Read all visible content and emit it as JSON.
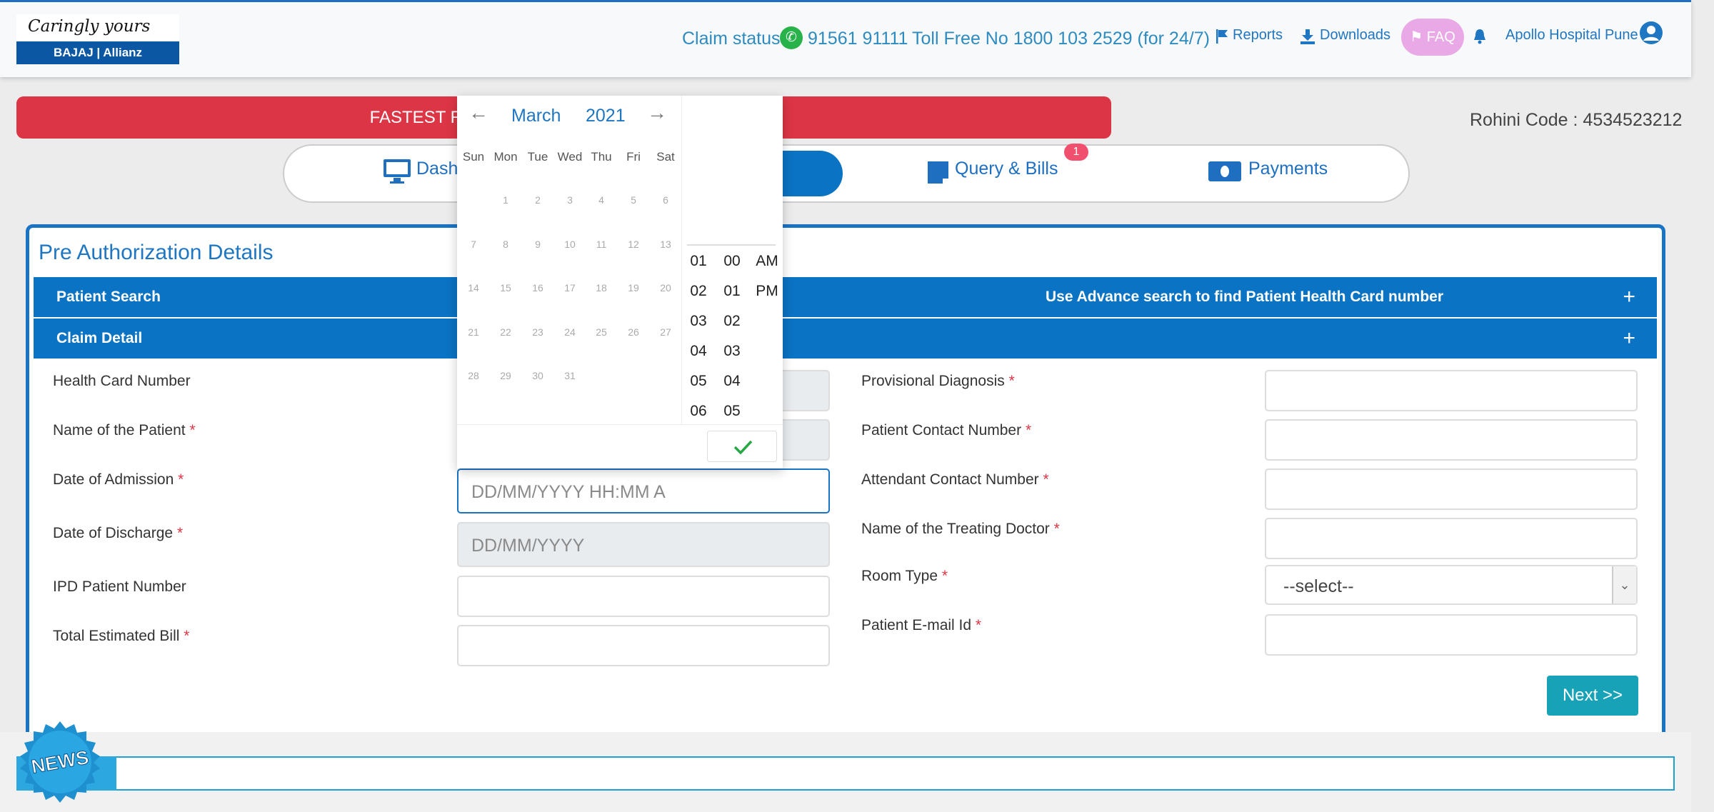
{
  "header": {
    "logo_tagline": "Caringly yours",
    "logo_brand": "BAJAJ | Allianz",
    "claim_status_label": "Claim status",
    "whatsapp_number": "91561 91111",
    "toll_free": "Toll Free No 1800 103 2529 (for 24/7)",
    "reports_label": "Reports",
    "downloads_label": "Downloads",
    "faq_label": "FAQ",
    "user_name": "Apollo Hospital Pune"
  },
  "banner": {
    "text": "FASTEST RESPONSE TO PRE-AUTHORIZATION"
  },
  "rohini_code": "Rohini Code : 4534523212",
  "nav": {
    "items": [
      {
        "label": "Dashboard"
      },
      {
        "label": "Query & Bills",
        "badge": "1"
      },
      {
        "label": "Payments"
      }
    ]
  },
  "card": {
    "title": "Pre Authorization Details",
    "patient_search": {
      "label": "Patient Search",
      "hint": "Use Advance search to find Patient Health Card number",
      "toggle": "+"
    },
    "claim_detail": {
      "label": "Claim Detail",
      "toggle": "+"
    },
    "left_fields": [
      {
        "label": "Health Card Number",
        "required": false,
        "value": ""
      },
      {
        "label": "Name of the Patient",
        "required": true,
        "value": ""
      },
      {
        "label": "Date of Admission",
        "required": true,
        "placeholder": "DD/MM/YYYY HH:MM A"
      },
      {
        "label": "Date of Discharge",
        "required": true,
        "placeholder": "DD/MM/YYYY"
      },
      {
        "label": "IPD Patient Number",
        "required": false,
        "value": ""
      },
      {
        "label": "Total Estimated Bill",
        "required": true,
        "value": ""
      }
    ],
    "right_fields": [
      {
        "label": "Provisional Diagnosis",
        "required": true,
        "value": ""
      },
      {
        "label": "Patient Contact Number",
        "required": true,
        "value": ""
      },
      {
        "label": "Attendant Contact Number",
        "required": true,
        "value": ""
      },
      {
        "label": "Name of the Treating Doctor",
        "required": true,
        "value": ""
      },
      {
        "label": "Room Type",
        "required": true,
        "selected": "--select--"
      },
      {
        "label": "Patient E-mail Id",
        "required": true,
        "value": ""
      }
    ],
    "required_marker": "*",
    "next_label": "Next >>"
  },
  "date_picker": {
    "prev": "←",
    "next": "→",
    "month": "March",
    "year": "2021",
    "weekdays": [
      "Sun",
      "Mon",
      "Tue",
      "Wed",
      "Thu",
      "Fri",
      "Sat"
    ],
    "days": [
      [
        "",
        "1",
        "2",
        "3",
        "4",
        "5",
        "6"
      ],
      [
        "7",
        "8",
        "9",
        "10",
        "11",
        "12",
        "13"
      ],
      [
        "14",
        "15",
        "16",
        "17",
        "18",
        "19",
        "20"
      ],
      [
        "21",
        "22",
        "23",
        "24",
        "25",
        "26",
        "27"
      ],
      [
        "28",
        "29",
        "30",
        "31",
        "",
        "",
        ""
      ]
    ],
    "hours": [
      "01",
      "02",
      "03",
      "04",
      "05",
      "06"
    ],
    "minutes": [
      "00",
      "01",
      "02",
      "03",
      "04",
      "05"
    ],
    "meridiem": [
      "AM",
      "PM"
    ]
  },
  "news_label": "NEWS",
  "colors": {
    "primary": "#0b73c4",
    "banner_red": "#dc3545",
    "next_teal": "#17a2b8",
    "whatsapp": "#27b24a",
    "faq_pink": "#e9a8e6"
  }
}
